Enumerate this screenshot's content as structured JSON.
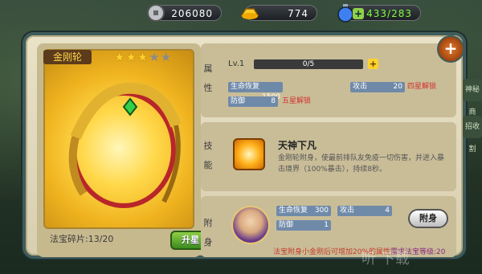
{
  "resources": {
    "silver": {
      "value": "206080",
      "icon": "silver-coin-icon"
    },
    "gold": {
      "value": "774",
      "icon": "gold-ingot-icon"
    },
    "stamina": {
      "value": "433/283",
      "icon": "potion-icon",
      "color": "#7fff3a"
    }
  },
  "treasure": {
    "name": "金刚轮",
    "stars_filled": 3,
    "stars_total": 5,
    "fragments": "法宝碎片:13/20",
    "upgrade_label": "升星"
  },
  "attributes": {
    "label": "属性",
    "level": "Lv.1",
    "xp": "0/5",
    "plus": "+",
    "stats": [
      {
        "name": "生命恢复",
        "value": "1500",
        "active": true
      },
      {
        "name": "攻击",
        "value": "20",
        "active": true
      },
      {
        "name": "四星解锁",
        "value": "",
        "active": false,
        "locked": true
      },
      {
        "name": "防御",
        "value": "8",
        "active": true
      },
      {
        "name": "五星解锁",
        "value": "",
        "active": false,
        "locked": true
      }
    ]
  },
  "skill": {
    "label": "技能",
    "name": "天神下凡",
    "description": "金刚轮附身，使最前排队友免疫一切伤害，并进入暴击境界（100%暴击），持续8秒。"
  },
  "attach": {
    "label": "附身",
    "stats": [
      {
        "name": "生命恢复",
        "value": "300"
      },
      {
        "name": "攻击",
        "value": "4"
      },
      {
        "name": "防御",
        "value": "1"
      }
    ],
    "button_label": "附身",
    "note": "法宝附身小金刚后可增加20%的属性",
    "requirement": "需求法宝等级:20"
  },
  "side_tabs": [
    "神秘商",
    "招收割"
  ],
  "watermark": "听 下载"
}
